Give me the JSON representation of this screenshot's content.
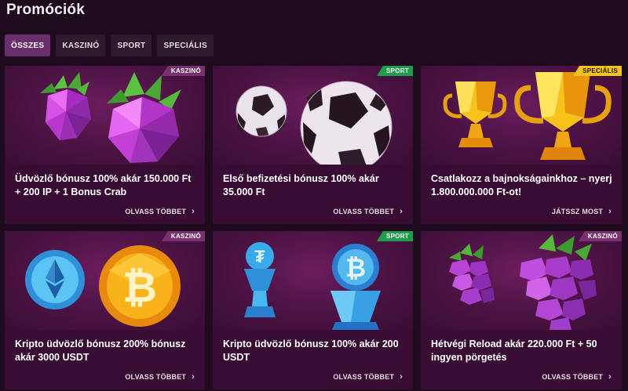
{
  "page": {
    "title": "Promóciók"
  },
  "tabs": [
    {
      "label": "ÖSSZES",
      "active": true
    },
    {
      "label": "KASZINÓ",
      "active": false
    },
    {
      "label": "SPORT",
      "active": false
    },
    {
      "label": "SPECIÁLIS",
      "active": false
    }
  ],
  "cards": [
    {
      "badge": "KASZINÓ",
      "title": "Üdvözlő bónusz 100% akár 150.000 Ft + 200 IP + 1 Bonus Crab",
      "link": "OLVASS TÖBBET",
      "art": "strawberry-gems"
    },
    {
      "badge": "SPORT",
      "title": "Első befizetési bónusz 100% akár 35.000 Ft",
      "link": "OLVASS TÖBBET",
      "art": "soccer-balls"
    },
    {
      "badge": "SPECIÁLIS",
      "title": "Csatlakozz a bajnokságainkhoz – nyerj 1.800.000.000 Ft-ot!",
      "link": "JÁTSSZ MOST",
      "art": "gold-trophies"
    },
    {
      "badge": "KASZINÓ",
      "title": "Kripto üdvözlő bónusz 200% bónusz akár 3000 USDT",
      "link": "OLVASS TÖBBET",
      "art": "crypto-coins"
    },
    {
      "badge": "SPORT",
      "title": "Kripto üdvözlő bónusz 100% akár 200 USDT",
      "link": "OLVASS TÖBBET",
      "art": "crypto-trophies"
    },
    {
      "badge": "KASZINÓ",
      "title": "Hétvégi Reload akár 220.000 Ft + 50 ingyen pörgetés",
      "link": "OLVASS TÖBBET",
      "art": "grape-gems"
    }
  ],
  "icons": {
    "link_arrow": "chevron-right-icon"
  },
  "colors": {
    "background": "#1e0c1e",
    "card": "#380c33",
    "tab_active": "#6a2f6a",
    "badge_kaszino": "#7a2f6e",
    "badge_sport": "#1f9d4a",
    "badge_specialis": "#f0c419"
  }
}
